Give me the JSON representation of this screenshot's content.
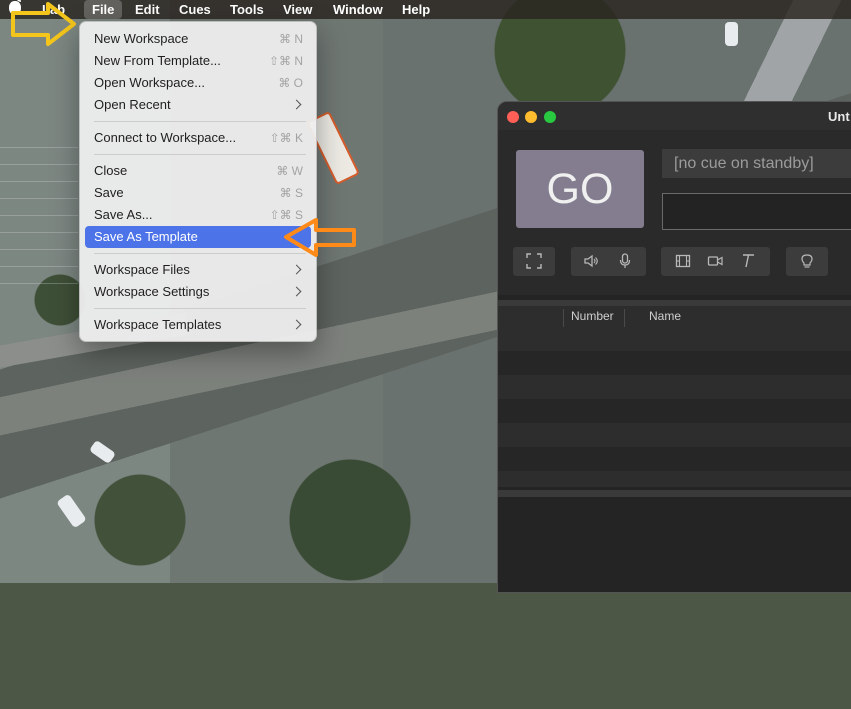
{
  "menubar": {
    "app_name": "Lab",
    "items": [
      "File",
      "Edit",
      "Cues",
      "Tools",
      "View",
      "Window",
      "Help"
    ],
    "selected": "File"
  },
  "file_menu": {
    "items": [
      {
        "label": "New Workspace",
        "shortcut": "⌘ N"
      },
      {
        "label": "New From Template...",
        "shortcut": "⇧⌘ N"
      },
      {
        "label": "Open Workspace...",
        "shortcut": "⌘ O"
      },
      {
        "label": "Open Recent",
        "submenu": true
      },
      {
        "label": "Connect to Workspace...",
        "shortcut": "⇧⌘ K"
      },
      {
        "label": "Close",
        "shortcut": "⌘ W"
      },
      {
        "label": "Save",
        "shortcut": "⌘ S"
      },
      {
        "label": "Save As...",
        "shortcut": "⇧⌘ S"
      },
      {
        "label": "Save As Template",
        "highlighted": true
      },
      {
        "label": "Workspace Files",
        "submenu": true
      },
      {
        "label": "Workspace Settings",
        "submenu": true
      },
      {
        "label": "Workspace Templates",
        "submenu": true
      }
    ]
  },
  "window": {
    "title": "Unt",
    "go_label": "GO",
    "standby_text": "[no cue on standby]",
    "columns": [
      "Number",
      "Name"
    ],
    "toolbar_icons": [
      "fullscreen-icon",
      "speaker-icon",
      "microphone-icon",
      "film-icon",
      "video-camera-icon",
      "text-icon",
      "light-bulb-icon"
    ]
  },
  "annotations": {
    "yellow_arrow_color": "#f4c51b",
    "orange_arrow_color": "#ff8a18"
  },
  "colors": {
    "menu_highlight": "#4d73e8",
    "go_button": "#847d8f"
  }
}
